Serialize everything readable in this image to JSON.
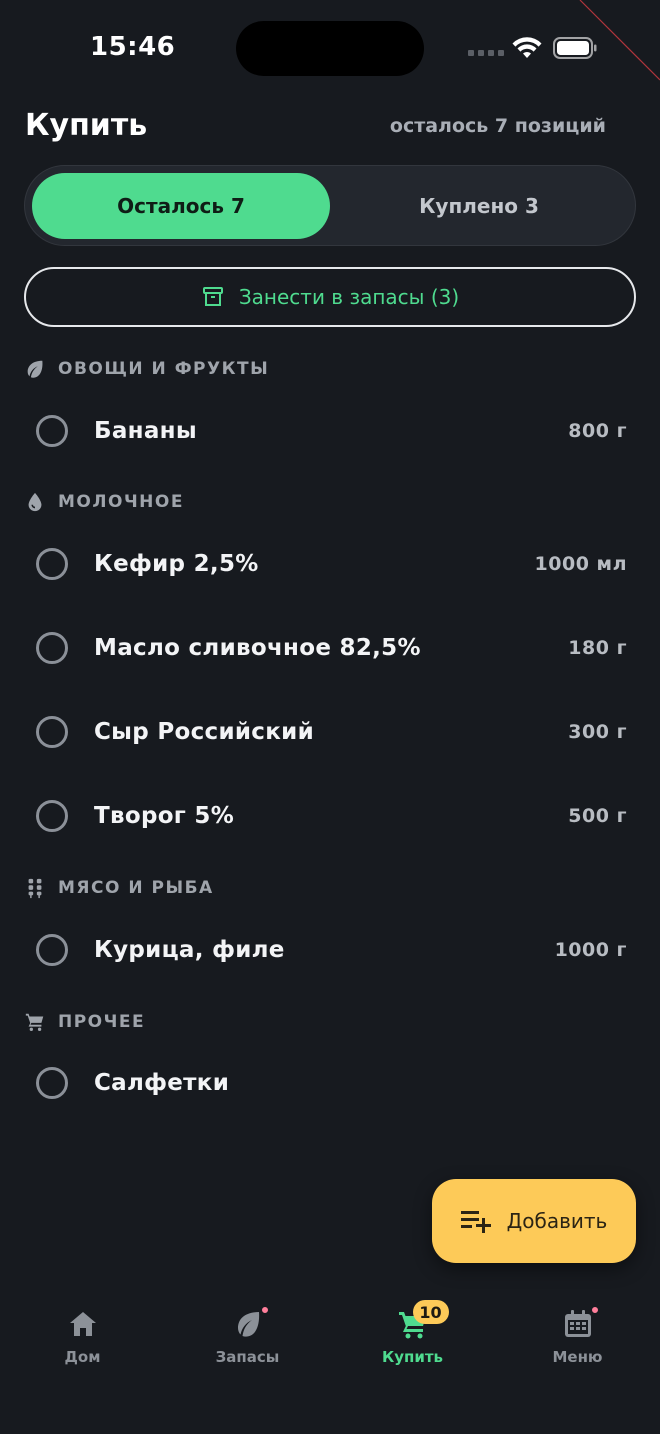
{
  "status_bar": {
    "time": "15:46"
  },
  "header": {
    "title": "Купить",
    "subtitle": "осталось 7 позиций"
  },
  "segments": {
    "remaining": "Осталось 7",
    "bought": "Куплено 3"
  },
  "stock_button": {
    "label": "Занести в запасы (3)"
  },
  "sections": [
    {
      "title": "ОВОЩИ И ФРУКТЫ",
      "icon": "leaf-icon",
      "items": [
        {
          "name": "Бананы",
          "qty": "800 г"
        }
      ]
    },
    {
      "title": "МОЛОЧНОЕ",
      "icon": "drop-icon",
      "items": [
        {
          "name": "Кефир 2,5%",
          "qty": "1000 мл"
        },
        {
          "name": "Масло сливочное 82,5%",
          "qty": "180 г"
        },
        {
          "name": "Сыр Российский",
          "qty": "300 г"
        },
        {
          "name": "Творог 5%",
          "qty": "500 г"
        }
      ]
    },
    {
      "title": "МЯСО И РЫБА",
      "icon": "kebab-icon",
      "items": [
        {
          "name": "Курица, филе",
          "qty": "1000 г"
        }
      ]
    },
    {
      "title": "ПРОЧЕЕ",
      "icon": "cart-icon",
      "items": [
        {
          "name": "Салфетки",
          "qty": ""
        }
      ]
    }
  ],
  "fab": {
    "label": "Добавить",
    "icon": "playlist-add-icon"
  },
  "tabs": [
    {
      "label": "Дом",
      "icon": "home-icon"
    },
    {
      "label": "Запасы",
      "icon": "leaf-icon"
    },
    {
      "label": "Купить",
      "icon": "cart-icon",
      "badge": "10"
    },
    {
      "label": "Меню",
      "icon": "calendar-icon"
    }
  ],
  "colors": {
    "accent": "#4fdb8f",
    "fab": "#fdca58",
    "background": "#171a1f",
    "notification_dot": "#ff7f9b"
  }
}
